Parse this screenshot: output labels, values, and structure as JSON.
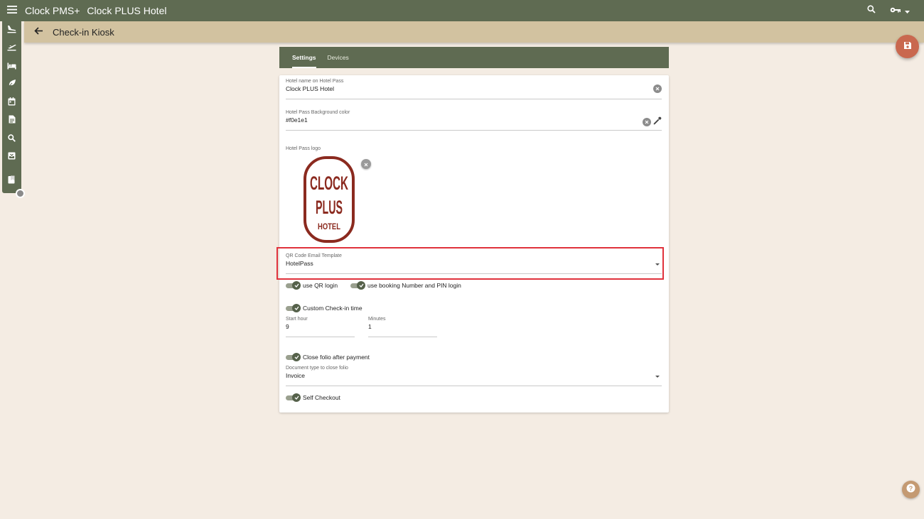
{
  "header": {
    "app_title": "Clock PMS+",
    "hotel_name": "Clock PLUS Hotel"
  },
  "subheader": {
    "title": "Check-in Kiosk"
  },
  "sidebar": {
    "icons": [
      "arrivals-icon",
      "departures-icon",
      "bed-icon",
      "leaf-icon",
      "calendar-icon",
      "document-icon",
      "search-icon",
      "inbox-icon",
      "bookmark-icon"
    ]
  },
  "tabs": [
    {
      "label": "Settings",
      "active": true
    },
    {
      "label": "Devices",
      "active": false
    }
  ],
  "form": {
    "hotel_name_field": {
      "label": "Hotel name on Hotel Pass",
      "value": "Clock PLUS Hotel"
    },
    "bg_color_field": {
      "label": "Hotel Pass Background color",
      "value": "#f0e1e1"
    },
    "logo_label": "Hotel Pass logo",
    "logo_text": [
      "CLOCK",
      "PLUS",
      "HOTEL"
    ],
    "qr_template_field": {
      "label": "QR Code Email Template",
      "value": "HotelPass"
    },
    "toggles": {
      "qr_login": {
        "label": "use QR login",
        "on": true
      },
      "booking_pin_login": {
        "label": "use booking Number and PIN login",
        "on": true
      },
      "custom_checkin_time": {
        "label": "Custom Check-in time",
        "on": true
      },
      "close_folio": {
        "label": "Close folio after payment",
        "on": true
      },
      "self_checkout": {
        "label": "Self Checkout",
        "on": true
      }
    },
    "start_hour": {
      "label": "Start hour",
      "value": "9"
    },
    "minutes": {
      "label": "Minutes",
      "value": "1"
    },
    "doc_type_field": {
      "label": "Document type to close folio",
      "value": "Invoice"
    }
  },
  "colors": {
    "primary": "#5f6b52",
    "accent_bar": "#d2c2a0",
    "background": "#f4ece3",
    "fab": "#c9684f",
    "logo_red": "#8b2a1f",
    "highlight": "#e0323c"
  }
}
